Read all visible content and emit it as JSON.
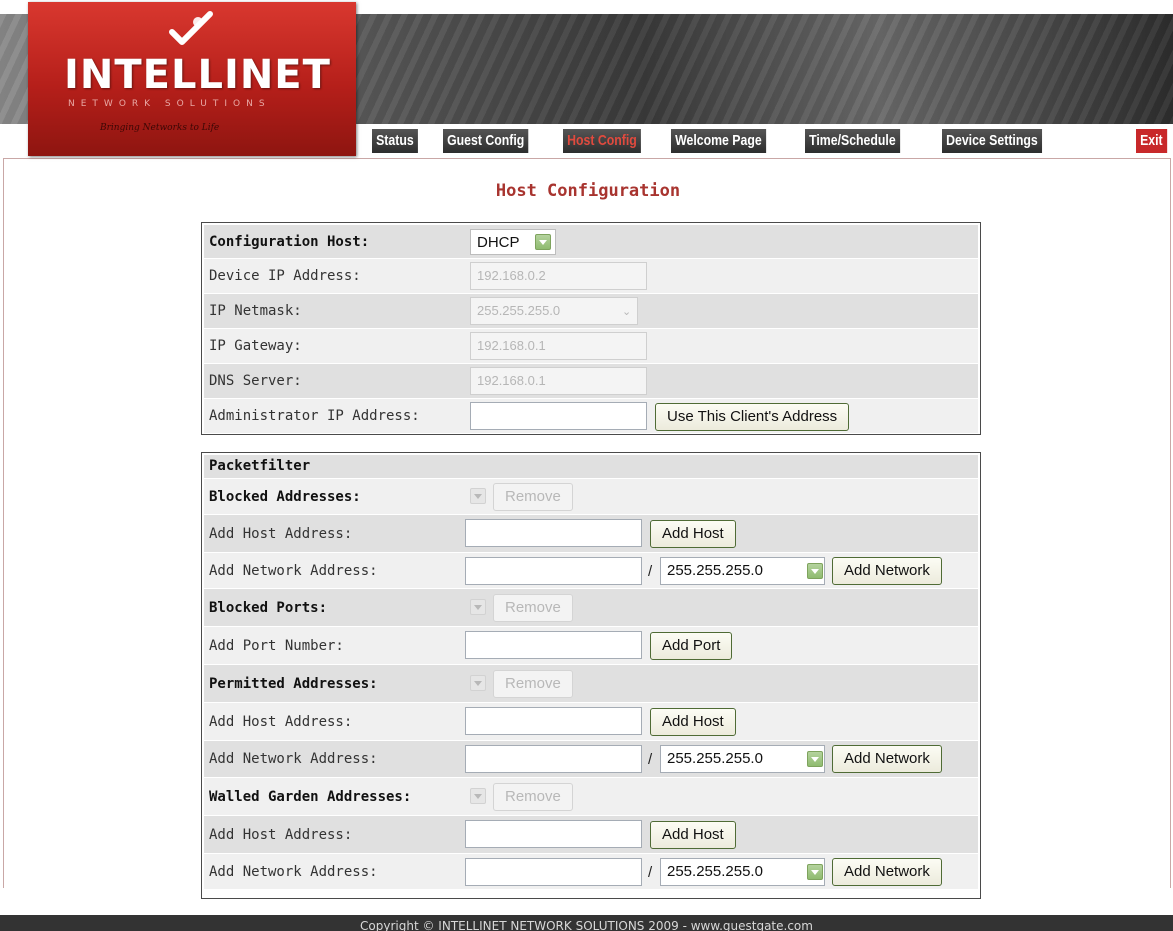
{
  "brand": {
    "name": "INTELLINET",
    "subline": "NETWORK SOLUTIONS",
    "tagline": "Bringing Networks to Life"
  },
  "nav": {
    "items": [
      {
        "label": "Status"
      },
      {
        "label": "Guest Config"
      },
      {
        "label": "Host Config"
      },
      {
        "label": "Welcome Page"
      },
      {
        "label": "Time/Schedule"
      },
      {
        "label": "Device Settings"
      }
    ],
    "exit": "Exit"
  },
  "page": {
    "title": "Host Configuration"
  },
  "host": {
    "config_label": "Configuration Host:",
    "config_value": "DHCP",
    "ip_label": "Device IP Address:",
    "ip_value": "192.168.0.2",
    "netmask_label": "IP Netmask:",
    "netmask_value": "255.255.255.0",
    "gateway_label": "IP Gateway:",
    "gateway_value": "192.168.0.1",
    "dns_label": "DNS Server:",
    "dns_value": "192.168.0.1",
    "admin_label": "Administrator IP Address:",
    "admin_value": "",
    "use_client_button": "Use This Client's Address"
  },
  "packetfilter": {
    "title": "Packetfilter",
    "remove": "Remove",
    "slash": "/",
    "mask": "255.255.255.0",
    "add_host_button": "Add Host",
    "add_network_button": "Add Network",
    "add_port_button": "Add Port",
    "add_host_label": "Add Host Address:",
    "add_network_label": "Add Network Address:",
    "add_port_label": "Add Port Number:",
    "blocked_addresses": "Blocked Addresses:",
    "blocked_ports": "Blocked Ports:",
    "permitted_addresses": "Permitted Addresses:",
    "walled_garden": "Walled Garden Addresses:"
  },
  "footer": {
    "text": "Copyright © INTELLINET NETWORK SOLUTIONS 2009 - www.guestgate.com"
  }
}
